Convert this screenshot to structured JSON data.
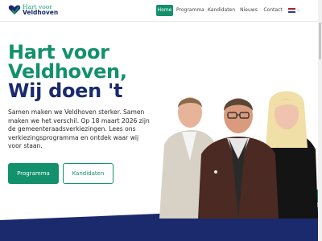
{
  "brand": {
    "line1": "Hart voor",
    "line2": "Veldhoven"
  },
  "nav": {
    "items": [
      "Home",
      "Programma",
      "Kandidaten",
      "Nieuws",
      "Contact"
    ],
    "active": "Home",
    "language": {
      "icon": "dutch-flag-icon",
      "dropdown_icon": "chevron-down-icon"
    }
  },
  "hero": {
    "title_line1": "Hart voor",
    "title_line2": "Veldhoven,",
    "title_line3": "Wij doen 't",
    "intro": "Samen maken we Veldhoven sterker. Samen maken we het verschil. Op 18 maart 2026 zijn de gemeenteraadsverkiezingen. Lees ons verkiezingsprogramma en ontdek waar wij voor staan.",
    "primary_button": "Programma",
    "secondary_button": "Kandidaten"
  },
  "colors": {
    "green": "#13906c",
    "navy": "#1a2a6c",
    "white": "#ffffff"
  }
}
